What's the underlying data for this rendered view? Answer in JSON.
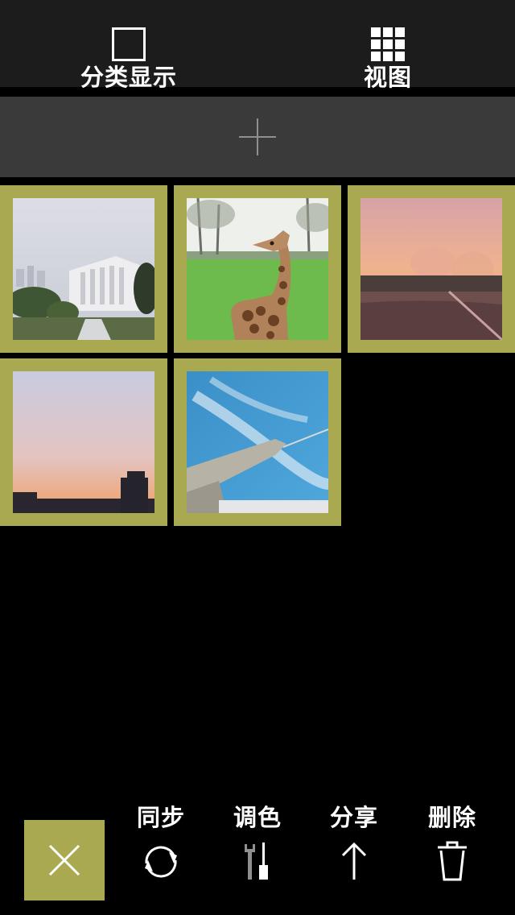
{
  "topbar": {
    "category_label": "分类显示",
    "view_label": "视图"
  },
  "add_bar": {
    "icon": "plus-icon"
  },
  "gallery": {
    "frame_color": "#a9a952",
    "photos": [
      {
        "subject": "campus-buildings"
      },
      {
        "subject": "giraffe"
      },
      {
        "subject": "sunset-river"
      },
      {
        "subject": "sunset-skyline"
      },
      {
        "subject": "airplane-sky"
      }
    ]
  },
  "toolbar": {
    "close_icon": "close-icon",
    "sync_label": "同步",
    "adjust_label": "调色",
    "share_label": "分享",
    "delete_label": "删除"
  }
}
